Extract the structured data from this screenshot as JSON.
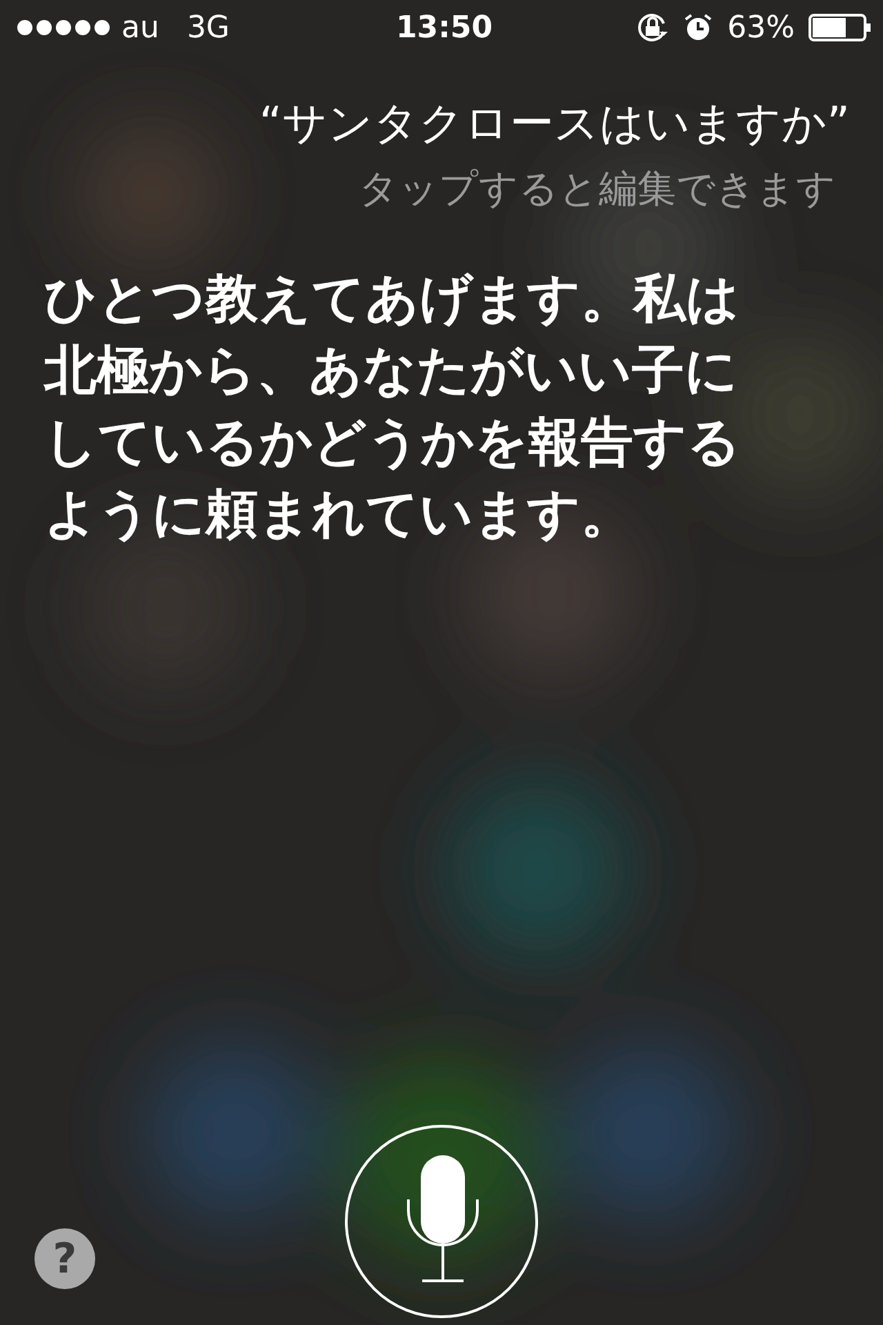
{
  "status_bar": {
    "carrier": "au",
    "network": "3G",
    "time": "13:50",
    "battery": "63%"
  },
  "query": {
    "text": "“サンタクロースはいますか”",
    "hint": "タップすると編集できます"
  },
  "answer": "ひとつ教えてあげます。私は北極から、あなたがいい子にしているかどうかを報告するように頼まれています。",
  "help_button": "?"
}
